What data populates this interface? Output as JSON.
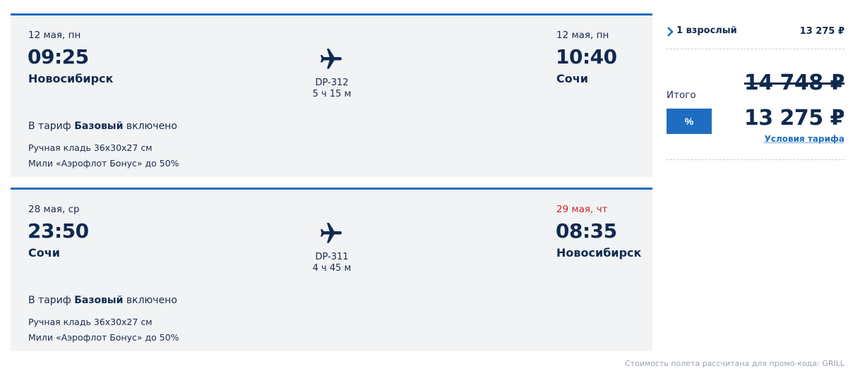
{
  "segments": [
    {
      "dep_date": "12 мая, пн",
      "dep_time": "09:25",
      "dep_city": "Новосибирск",
      "arr_date": "12 мая, пн",
      "arr_date_color": "#1b2b4b",
      "arr_time": "10:40",
      "arr_city": "Сочи",
      "plane_icon": "plane-icon",
      "flight_no": "DP-312",
      "duration": "5 ч 15 м",
      "tariff_prefix": "В тариф ",
      "tariff_name": "Базовый",
      "tariff_suffix": " включено",
      "features": [
        "Ручная кладь 36x30x27 см",
        "Мили «Аэрофлот Бонус» до 50%"
      ]
    },
    {
      "dep_date": "28 мая, ср",
      "dep_time": "23:50",
      "dep_city": "Сочи",
      "arr_date": "29 мая, чт",
      "arr_date_color": "#c8282e",
      "arr_time": "08:35",
      "arr_city": "Новосибирск",
      "plane_icon": "plane-icon",
      "flight_no": "DP-311",
      "duration": "4 ч 45 м",
      "tariff_prefix": "В тариф ",
      "tariff_name": "Базовый",
      "tariff_suffix": " включено",
      "features": [
        "Ручная кладь 36x30x27 см",
        "Мили «Аэрофлот Бонус» до 50%"
      ]
    }
  ],
  "summary": {
    "passenger_label": "1 взрослый",
    "passenger_price": "13 275 ₽",
    "total_label": "Итого",
    "old_price": "14 748 ₽",
    "promo_button": "%",
    "new_price": "13 275 ₽",
    "conditions_link": "Условия тарифа"
  },
  "footnote": "Стоимость полета рассчитана для промо-кода: GRILL",
  "colors": {
    "accent": "#1f6dc0",
    "text_dark": "#10294f",
    "warning": "#c8282e",
    "segment_bg": "#f1f3f4"
  }
}
